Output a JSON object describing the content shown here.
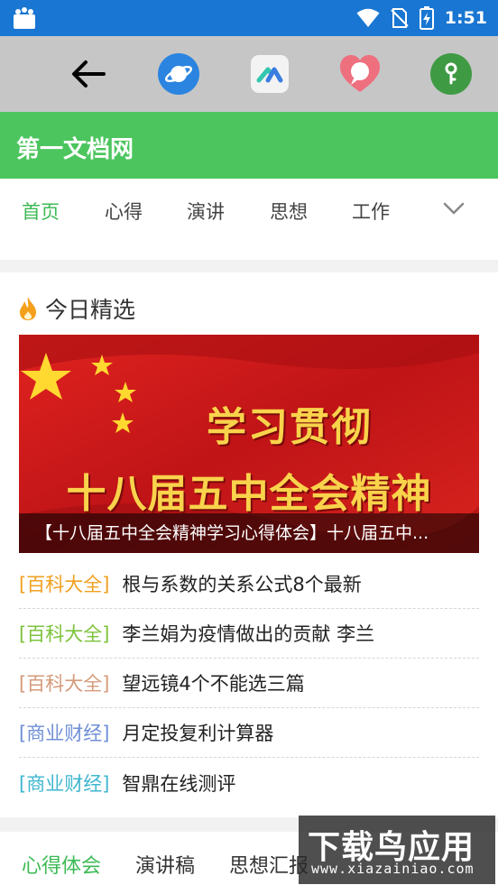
{
  "status_bar": {
    "time": "1:51"
  },
  "toolbar": {
    "buttons": [
      "back-arrow-icon",
      "planet-icon",
      "app-logo-icon",
      "chat-heart-icon",
      "key-icon"
    ]
  },
  "header": {
    "title": "第一文档网"
  },
  "category_nav": {
    "items": [
      {
        "label": "首页",
        "active": true
      },
      {
        "label": "心得",
        "active": false
      },
      {
        "label": "演讲",
        "active": false
      },
      {
        "label": "思想",
        "active": false
      },
      {
        "label": "工作",
        "active": false
      }
    ]
  },
  "today": {
    "title": "今日精选",
    "banner": {
      "line1": "学习贯彻",
      "line2": "十八届五中全会精神",
      "caption": "【十八届五中全会精神学习心得体会】十八届五中..."
    },
    "news": [
      {
        "tag": "[百科大全]",
        "tag_color": "#f0a020",
        "title": "根与系数的关系公式8个最新"
      },
      {
        "tag": "[百科大全]",
        "tag_color": "#7dc33a",
        "title": "李兰娟为疫情做出的贡献 李兰"
      },
      {
        "tag": "[百科大全]",
        "tag_color": "#d59a7a",
        "title": "望远镜4个不能选三篇"
      },
      {
        "tag": "[商业财经]",
        "tag_color": "#6f8fd6",
        "title": "月定投复利计算器"
      },
      {
        "tag": "[商业财经]",
        "tag_color": "#3fb6cf",
        "title": "智鼎在线测评"
      }
    ]
  },
  "bottom_tabs": [
    {
      "label": "心得体会",
      "active": true
    },
    {
      "label": "演讲稿",
      "active": false
    },
    {
      "label": "思想汇报",
      "active": false
    }
  ],
  "watermark": {
    "main": "下载鸟应用",
    "sub": "www.xiazainiao.com"
  },
  "colors": {
    "status_bar": "#1976d2",
    "header": "#4cc55e",
    "accent": "#3dba55",
    "toolbar": "#c6c6c6"
  }
}
